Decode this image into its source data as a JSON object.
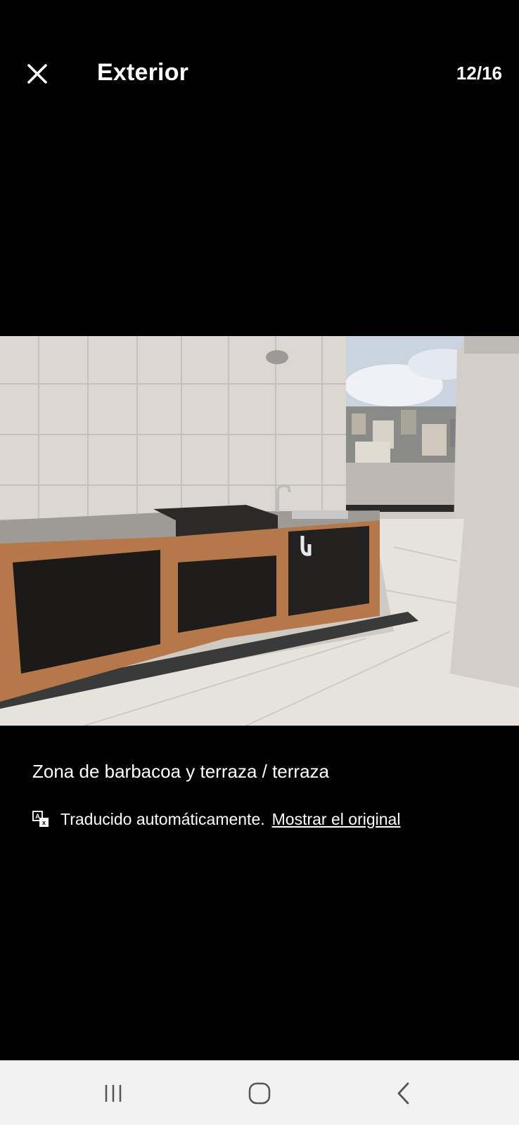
{
  "header": {
    "close_icon": "close-icon",
    "title": "Exterior",
    "counter": "12/16"
  },
  "photo": {
    "subject": "bbq-terrace-photo"
  },
  "caption": "Zona de barbacoa y terraza / terraza",
  "translation": {
    "icon": "translate-icon",
    "note": "Traducido automáticamente.",
    "link": "Mostrar el original"
  },
  "navbar": {
    "recent_icon": "recent-apps-icon",
    "home_icon": "home-icon",
    "back_icon": "back-icon"
  },
  "colors": {
    "background": "#000000",
    "navbar": "#f2f2f2",
    "nav_icons": "#555555"
  }
}
